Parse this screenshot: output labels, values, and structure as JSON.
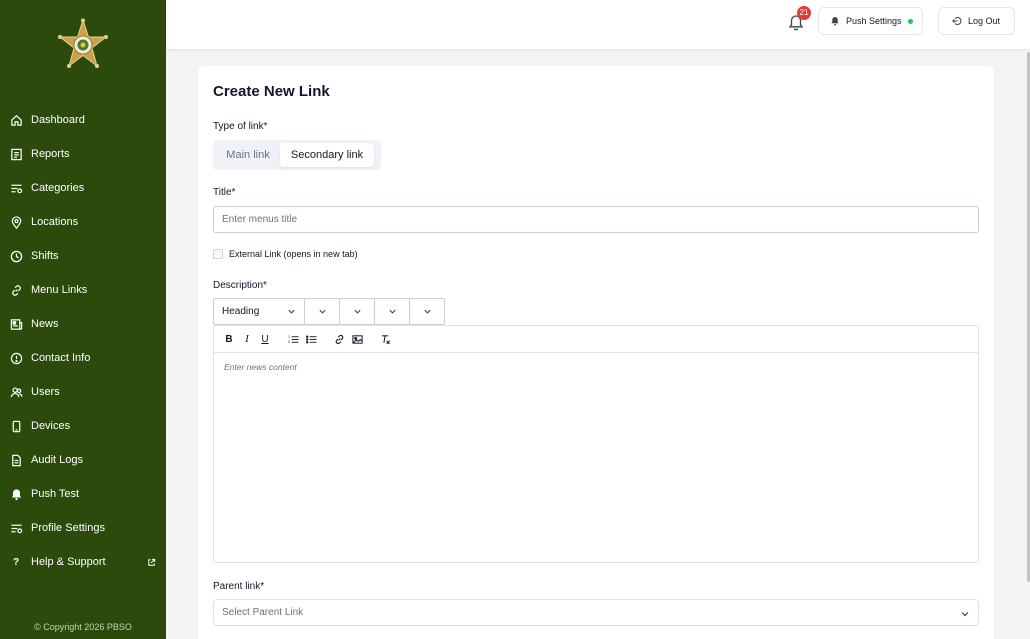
{
  "sidebar": {
    "items": [
      {
        "label": "Dashboard",
        "icon": "home-icon"
      },
      {
        "label": "Reports",
        "icon": "reports-icon"
      },
      {
        "label": "Categories",
        "icon": "categories-icon"
      },
      {
        "label": "Locations",
        "icon": "location-pin-icon"
      },
      {
        "label": "Shifts",
        "icon": "clock-icon"
      },
      {
        "label": "Menu Links",
        "icon": "link-icon"
      },
      {
        "label": "News",
        "icon": "newspaper-icon"
      },
      {
        "label": "Contact Info",
        "icon": "info-icon"
      },
      {
        "label": "Users",
        "icon": "users-icon"
      },
      {
        "label": "Devices",
        "icon": "phone-icon"
      },
      {
        "label": "Audit Logs",
        "icon": "document-icon"
      },
      {
        "label": "Push Test",
        "icon": "bell-icon"
      },
      {
        "label": "Profile Settings",
        "icon": "settings-sliders-icon"
      },
      {
        "label": "Help & Support",
        "icon": "question-icon"
      }
    ],
    "copyright": "© Copyright 2026 PBSO"
  },
  "topbar": {
    "notification_count": "21",
    "push_settings_label": "Push Settings",
    "logout_label": "Log Out"
  },
  "form": {
    "title": "Create New Link",
    "type_label": "Type of link*",
    "type_options": [
      "Main link",
      "Secondary link"
    ],
    "type_selected": "Secondary link",
    "title_label": "Title*",
    "title_placeholder": "Enter menus title",
    "external_label": "External Link (opens in new tab)",
    "external_checked": false,
    "description_label": "Description*",
    "heading_select": "Heading",
    "editor_placeholder": "Enter news content",
    "parent_label": "Parent link*",
    "parent_placeholder": "Select Parent Link"
  },
  "colors": {
    "sidebar_bg": "#2c4a0c",
    "badge": "#e53935",
    "status_dot": "#22c55e"
  }
}
